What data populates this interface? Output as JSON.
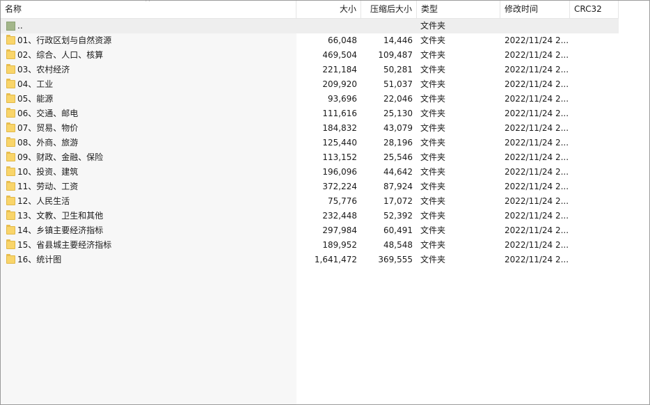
{
  "columns": {
    "name": "名称",
    "size": "大小",
    "packed": "压缩后大小",
    "type": "类型",
    "modified": "修改时间",
    "crc": "CRC32"
  },
  "parent_row": {
    "name": "..",
    "type": "文件夹"
  },
  "rows": [
    {
      "name": "01、行政区划与自然资源",
      "size": "66,048",
      "packed": "14,446",
      "type": "文件夹",
      "modified": "2022/11/24 2..."
    },
    {
      "name": "02、综合、人口、核算",
      "size": "469,504",
      "packed": "109,487",
      "type": "文件夹",
      "modified": "2022/11/24 2..."
    },
    {
      "name": "03、农村经济",
      "size": "221,184",
      "packed": "50,281",
      "type": "文件夹",
      "modified": "2022/11/24 2..."
    },
    {
      "name": "04、工业",
      "size": "209,920",
      "packed": "51,037",
      "type": "文件夹",
      "modified": "2022/11/24 2..."
    },
    {
      "name": "05、能源",
      "size": "93,696",
      "packed": "22,046",
      "type": "文件夹",
      "modified": "2022/11/24 2..."
    },
    {
      "name": "06、交通、邮电",
      "size": "111,616",
      "packed": "25,130",
      "type": "文件夹",
      "modified": "2022/11/24 2..."
    },
    {
      "name": "07、贸易、物价",
      "size": "184,832",
      "packed": "43,079",
      "type": "文件夹",
      "modified": "2022/11/24 2..."
    },
    {
      "name": "08、外商、旅游",
      "size": "125,440",
      "packed": "28,196",
      "type": "文件夹",
      "modified": "2022/11/24 2..."
    },
    {
      "name": "09、财政、金融、保险",
      "size": "113,152",
      "packed": "25,546",
      "type": "文件夹",
      "modified": "2022/11/24 2..."
    },
    {
      "name": "10、投资、建筑",
      "size": "196,096",
      "packed": "44,642",
      "type": "文件夹",
      "modified": "2022/11/24 2..."
    },
    {
      "name": "11、劳动、工资",
      "size": "372,224",
      "packed": "87,924",
      "type": "文件夹",
      "modified": "2022/11/24 2..."
    },
    {
      "name": "12、人民生活",
      "size": "75,776",
      "packed": "17,072",
      "type": "文件夹",
      "modified": "2022/11/24 2..."
    },
    {
      "name": "13、文教、卫生和其他",
      "size": "232,448",
      "packed": "52,392",
      "type": "文件夹",
      "modified": "2022/11/24 2..."
    },
    {
      "name": "14、乡镇主要经济指标",
      "size": "297,984",
      "packed": "60,491",
      "type": "文件夹",
      "modified": "2022/11/24 2..."
    },
    {
      "name": "15、省县城主要经济指标",
      "size": "189,952",
      "packed": "48,548",
      "type": "文件夹",
      "modified": "2022/11/24 2..."
    },
    {
      "name": "16、统计图",
      "size": "1,641,472",
      "packed": "369,555",
      "type": "文件夹",
      "modified": "2022/11/24 2..."
    }
  ],
  "icons": {
    "sort": "sort-ascending-icon",
    "folder": "folder-icon",
    "parent": "parent-folder-icon"
  }
}
